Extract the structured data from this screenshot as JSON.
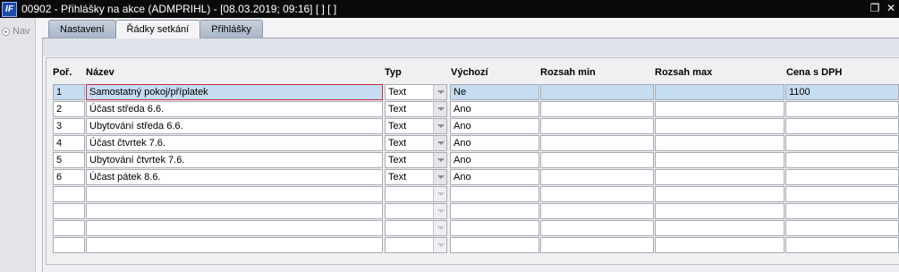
{
  "window": {
    "title": "00902 - Přihlášky na akce (ADMPRIHL) - [08.03.2019; 09:16]  [ ]  [ ]",
    "logo_text": "IF"
  },
  "left_panel": {
    "nav_label": "Nav"
  },
  "tabs": [
    {
      "label": "Nastavení",
      "active": false
    },
    {
      "label": "Řádky setkání",
      "active": true
    },
    {
      "label": "Přihlášky",
      "active": false
    }
  ],
  "table": {
    "headers": {
      "por": "Poř.",
      "nazev": "Název",
      "typ": "Typ",
      "vychozi": "Výchozí",
      "rozsah_min": "Rozsah min",
      "rozsah_max": "Rozsah max",
      "cena": "Cena s DPH"
    },
    "rows": [
      {
        "por": "1",
        "nazev": "Samostatný pokoj/příplatek",
        "typ": "Text",
        "vychozi": "Ne",
        "rozsah_min": "",
        "rozsah_max": "",
        "cena": "1100"
      },
      {
        "por": "2",
        "nazev": "Účast středa 6.6.",
        "typ": "Text",
        "vychozi": "Ano",
        "rozsah_min": "",
        "rozsah_max": "",
        "cena": ""
      },
      {
        "por": "3",
        "nazev": "Ubytování středa 6.6.",
        "typ": "Text",
        "vychozi": "Ano",
        "rozsah_min": "",
        "rozsah_max": "",
        "cena": ""
      },
      {
        "por": "4",
        "nazev": "Účast čtvrtek 7.6.",
        "typ": "Text",
        "vychozi": "Ano",
        "rozsah_min": "",
        "rozsah_max": "",
        "cena": ""
      },
      {
        "por": "5",
        "nazev": "Ubytování čtvrtek 7.6.",
        "typ": "Text",
        "vychozi": "Ano",
        "rozsah_min": "",
        "rozsah_max": "",
        "cena": ""
      },
      {
        "por": "6",
        "nazev": "Účast pátek 8.6.",
        "typ": "Text",
        "vychozi": "Ano",
        "rozsah_min": "",
        "rozsah_max": "",
        "cena": ""
      },
      {
        "por": "",
        "nazev": "",
        "typ": "",
        "vychozi": "",
        "rozsah_min": "",
        "rozsah_max": "",
        "cena": ""
      },
      {
        "por": "",
        "nazev": "",
        "typ": "",
        "vychozi": "",
        "rozsah_min": "",
        "rozsah_max": "",
        "cena": ""
      },
      {
        "por": "",
        "nazev": "",
        "typ": "",
        "vychozi": "",
        "rozsah_min": "",
        "rozsah_max": "",
        "cena": ""
      },
      {
        "por": "",
        "nazev": "",
        "typ": "",
        "vychozi": "",
        "rozsah_min": "",
        "rozsah_max": "",
        "cena": ""
      }
    ],
    "selected_row": 0
  }
}
